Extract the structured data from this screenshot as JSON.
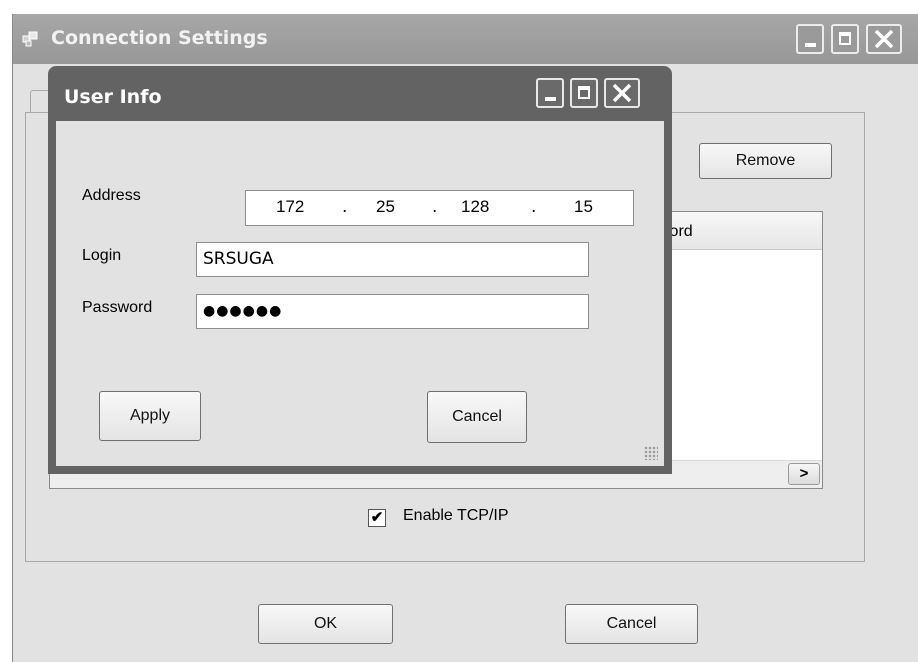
{
  "outer_window": {
    "title": "Connection Settings",
    "remove_button": "Remove",
    "list_column_password": "word",
    "checkbox": {
      "label": "Enable TCP/IP",
      "checked": true,
      "mark": "✔"
    },
    "ok_button": "OK",
    "cancel_button": "Cancel",
    "scroll_right_glyph": ">"
  },
  "dialog": {
    "title": "User Info",
    "address_label": "Address",
    "address": {
      "o1": "172",
      "o2": "25",
      "o3": "128",
      "o4": "15",
      "separator": "."
    },
    "login_label": "Login",
    "login_value": "SRSUGA",
    "password_label": "Password",
    "password_masked": "●●●●●●",
    "apply_button": "Apply",
    "cancel_button": "Cancel"
  },
  "colors": {
    "outer_titlebar": "#a0a0a0",
    "dialog_titlebar": "#636363",
    "client": "#e2e2e2"
  },
  "icons": [
    "window-app-icon",
    "minimize-icon",
    "maximize-icon",
    "close-icon",
    "scroll-right-arrow-icon",
    "checkmark-icon",
    "resize-grip-icon"
  ]
}
